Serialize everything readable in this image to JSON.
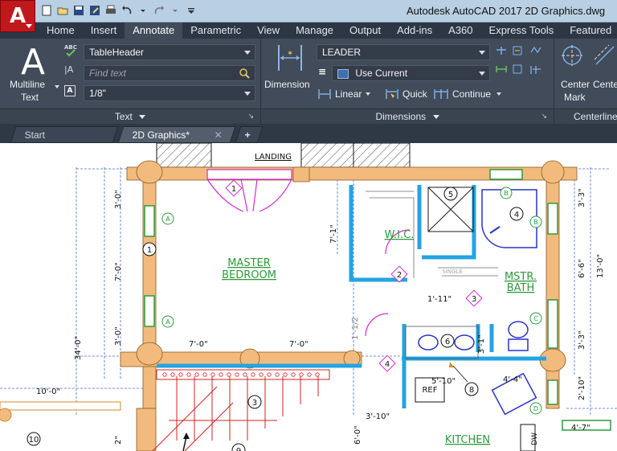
{
  "app": {
    "logo_letter": "A",
    "title": "Autodesk AutoCAD 2017    2D Graphics.dwg"
  },
  "ribbon_tabs": [
    "Home",
    "Insert",
    "Annotate",
    "Parametric",
    "View",
    "Manage",
    "Output",
    "Add-ins",
    "A360",
    "Express Tools",
    "Featured"
  ],
  "active_tab": "Annotate",
  "text_panel": {
    "multiline_label_1": "Multiline",
    "multiline_label_2": "Text",
    "style": "TableHeader",
    "find_placeholder": "Find text",
    "height": "1/8\"",
    "footer": "Text"
  },
  "dimensions_panel": {
    "dimension_label": "Dimension",
    "style": "LEADER",
    "layer": "Use Current",
    "linear": "Linear",
    "quick": "Quick",
    "continue": "Continue",
    "footer": "Dimensions"
  },
  "centerlines_panel": {
    "center_mark_1": "Center",
    "center_mark_2": "Mark",
    "centerline_1": "Cente",
    "footer": "Centerline"
  },
  "doc_tabs": {
    "start": "Start",
    "active": "2D Graphics*"
  },
  "drawing": {
    "landing": "LANDING",
    "master_1": "MASTER",
    "master_2": "BEDROOM",
    "wic": "W.I.C.",
    "mstr_1": "MSTR.",
    "mstr_2": "BATH",
    "single": "SINGLE",
    "ref": "REF",
    "kitchen": "KITCHEN",
    "dw": "DW",
    "dims": {
      "d1": "3'-0\"",
      "d2": "7'-0\"",
      "d3": "3'-0\"",
      "d4": "34'-0\"",
      "d5": "7'-0\"",
      "d6": "7'-0\"",
      "d7": "10'-0\"",
      "d8": "7'-1\"",
      "d9": "1'-11\"",
      "d10": "1'-1/2",
      "d11": "5'-10\"",
      "d12": "4'-4\"",
      "d13": "3'-10\"",
      "d14": "3'-3\"",
      "d15": "6'-6\"",
      "d16": "13'-0\"",
      "d17": "3'-3\"",
      "d18": "2'-10\"",
      "d19": "4'-7\"",
      "d20": "6'-0\"",
      "d21": "3'-1\"",
      "d22": "2\""
    },
    "tags": [
      "1",
      "2",
      "3",
      "4",
      "5",
      "6",
      "8",
      "9",
      "10"
    ],
    "window_tags": [
      "A",
      "A",
      "B",
      "B",
      "C",
      "D"
    ]
  }
}
